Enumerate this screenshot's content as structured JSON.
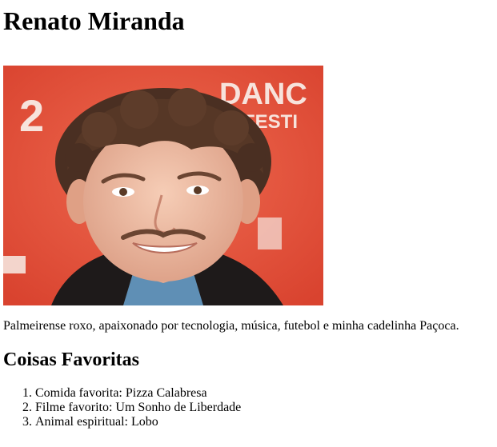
{
  "profile": {
    "name": "Renato Miranda",
    "photo_alt": "Renato Miranda",
    "bio": "Palmeirense roxo, apaixonado por tecnologia, música, futebol e minha cadelinha Paçoca."
  },
  "favorites": {
    "title": "Coisas Favoritas",
    "items": [
      "Comida favorita: Pizza Calabresa",
      "Filme favorito: Um Sonho de Liberdade",
      "Animal espiritual: Lobo"
    ]
  },
  "photo_backdrop": {
    "text_line_1": "DANC",
    "text_line_2": "FESTI",
    "left_text": "2",
    "color": "#e9503b"
  }
}
